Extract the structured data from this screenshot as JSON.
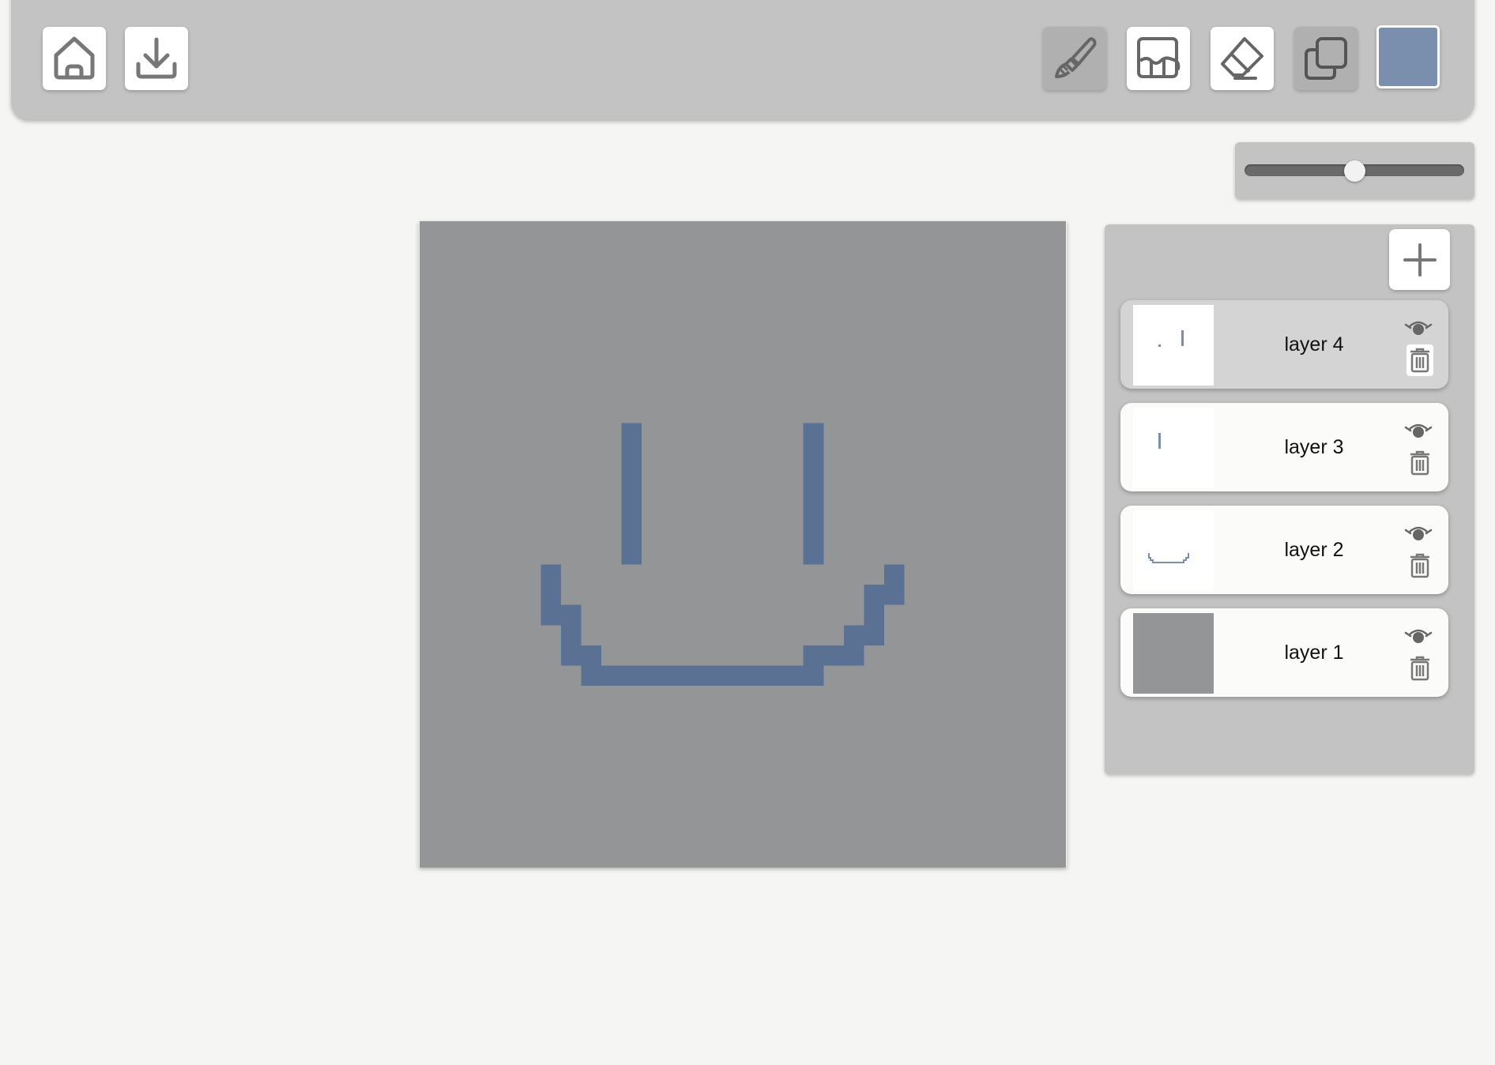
{
  "toolbar": {
    "home_icon": "home-icon",
    "download_icon": "download-icon",
    "tools": [
      {
        "id": "brush",
        "icon": "brush-icon",
        "active": true
      },
      {
        "id": "fill",
        "icon": "paint-bucket-icon",
        "active": false
      },
      {
        "id": "eraser",
        "icon": "eraser-icon",
        "active": false
      },
      {
        "id": "copy",
        "icon": "copy-icon",
        "active": true
      }
    ],
    "current_color": "#7a8fae"
  },
  "brush_size": {
    "value_fraction": 0.5
  },
  "canvas": {
    "background": "#949597",
    "ink": "#5a7194"
  },
  "layers_panel": {
    "add_icon": "plus-icon",
    "layers": [
      {
        "name": "layer 4",
        "selected": true,
        "visible": true
      },
      {
        "name": "layer 3",
        "selected": false,
        "visible": true
      },
      {
        "name": "layer 2",
        "selected": false,
        "visible": true
      },
      {
        "name": "layer 1",
        "selected": false,
        "visible": true
      }
    ]
  }
}
